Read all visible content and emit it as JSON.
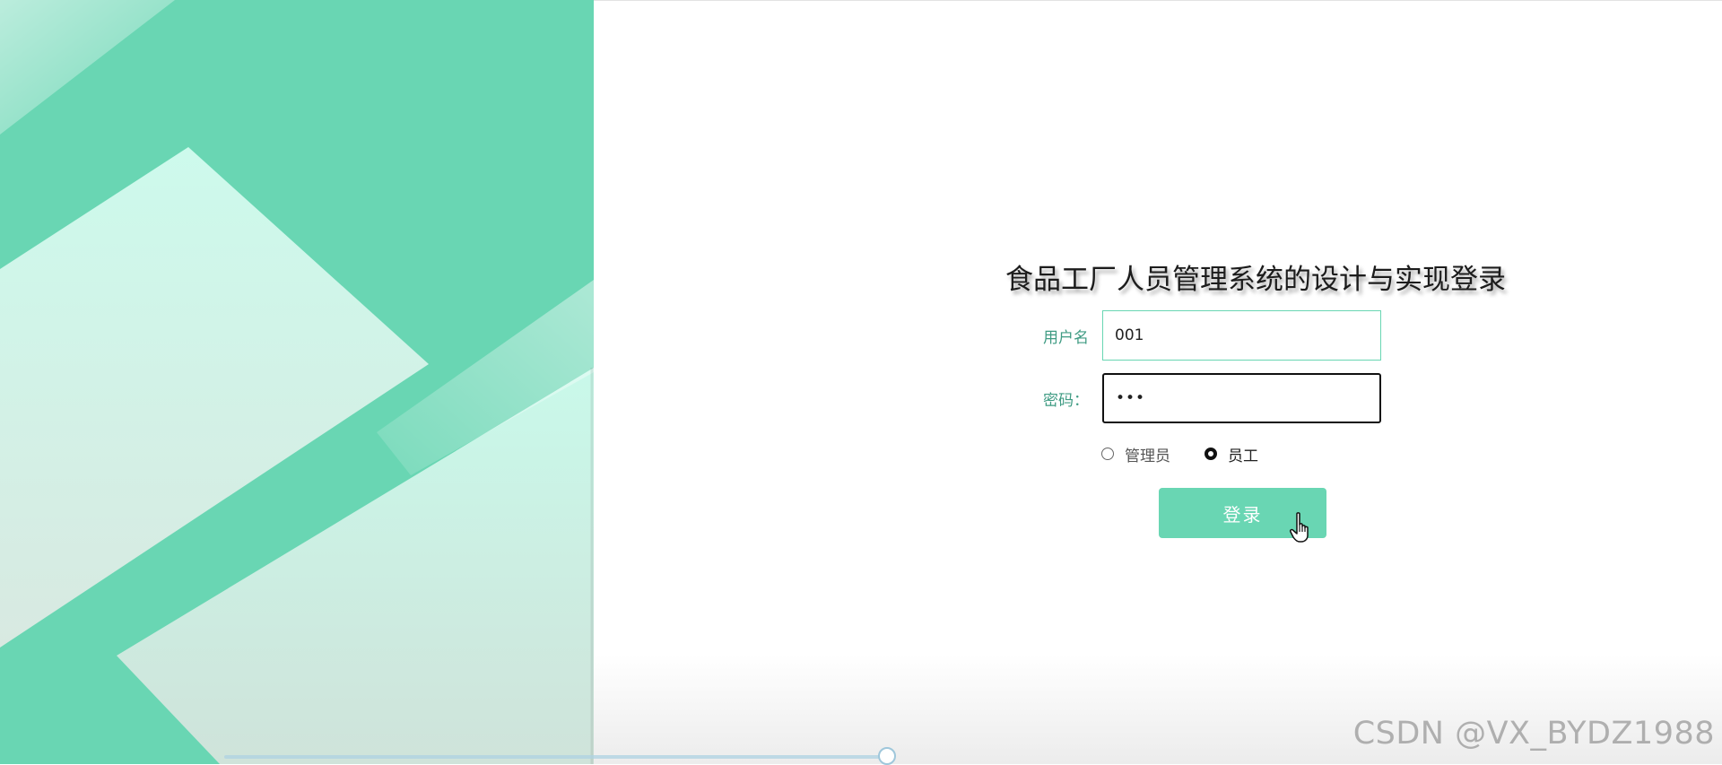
{
  "app": {
    "title": "食品工厂人员管理系统的设计与实现登录"
  },
  "form": {
    "username_label": "用户名",
    "username_value": "001",
    "password_label": "密码：",
    "password_value": "•••",
    "roles": [
      {
        "label": "管理员",
        "checked": false
      },
      {
        "label": "员工",
        "checked": true
      }
    ],
    "login_label": "登录"
  },
  "watermark": "CSDN @VX_BYDZ1988",
  "colors": {
    "accent": "#69d6b3",
    "panel_background": "#69d6b3",
    "label_text": "#3f9b83",
    "title_text": "#1c1c1c"
  },
  "icons": {
    "cursor": "hand-pointer-icon"
  }
}
